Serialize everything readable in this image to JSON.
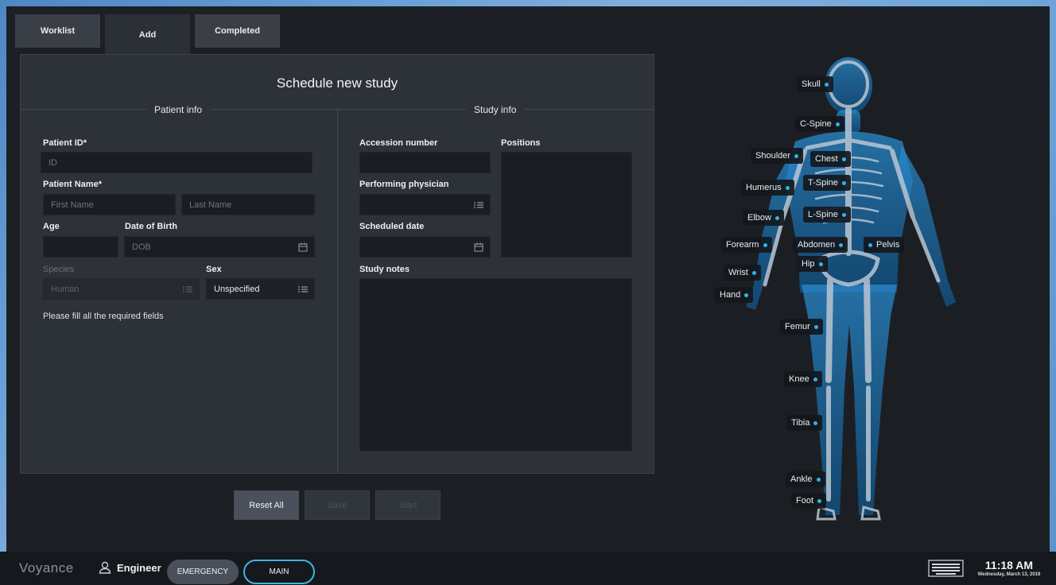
{
  "tabs": [
    {
      "label": "Worklist",
      "active": false
    },
    {
      "label": "Add",
      "active": true
    },
    {
      "label": "Completed",
      "active": false
    }
  ],
  "form": {
    "title": "Schedule new study",
    "patient_info_header": "Patient info",
    "study_info_header": "Study info",
    "patient_id": {
      "label": "Patient ID*",
      "placeholder": "ID"
    },
    "patient_name": {
      "label": "Patient Name*",
      "first_placeholder": "First Name",
      "last_placeholder": "Last Name"
    },
    "age": {
      "label": "Age",
      "value": ""
    },
    "dob": {
      "label": "Date of Birth",
      "placeholder": "DOB"
    },
    "species": {
      "label": "Species",
      "value": "Human"
    },
    "sex": {
      "label": "Sex",
      "value": "Unspecified"
    },
    "required_hint": "Please fill all the required fields",
    "accession": {
      "label": "Accession number",
      "value": ""
    },
    "positions": {
      "label": "Positions"
    },
    "physician": {
      "label": "Performing physician",
      "value": ""
    },
    "scheduled_date": {
      "label": "Scheduled date",
      "value": ""
    },
    "study_notes": {
      "label": "Study notes",
      "value": ""
    }
  },
  "buttons": {
    "reset": "Reset All",
    "save": "Save",
    "start": "Start"
  },
  "body_parts": [
    "Skull",
    "C-Spine",
    "Shoulder",
    "Chest",
    "Humerus",
    "T-Spine",
    "Elbow",
    "L-Spine",
    "Forearm",
    "Abdomen",
    "Pelvis",
    "Hip",
    "Wrist",
    "Hand",
    "Femur",
    "Knee",
    "Tibia",
    "Ankle",
    "Foot"
  ],
  "status_bar": {
    "brand": "Voyance",
    "user": "Engineer",
    "emergency_label": "EMERGENCY",
    "main_label": "MAIN",
    "time": "11:18 AM",
    "date": "Wednesday, March 13, 2019"
  },
  "colors": {
    "accent": "#3bb6e8",
    "pin_dot": "#2fb4e8",
    "body_glow": "#1d7fc0"
  },
  "icons": {
    "calendar": "calendar-icon",
    "list": "list-icon",
    "user": "user-icon",
    "keyboard": "keyboard-icon"
  }
}
